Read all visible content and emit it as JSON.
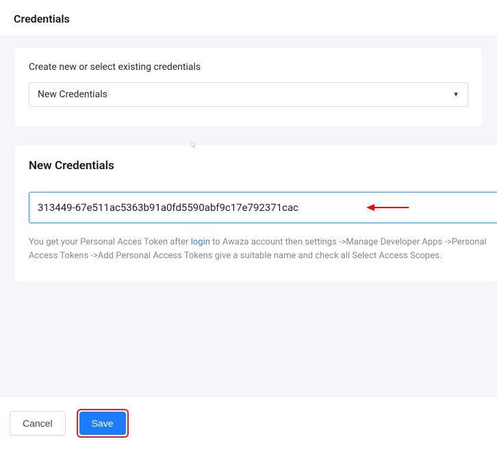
{
  "header": {
    "title": "Credentials"
  },
  "select_panel": {
    "label": "Create new or select existing credentials",
    "selected": "New Credentials"
  },
  "token_panel": {
    "heading": "New Credentials",
    "input_value": "313449-67e511ac5363b91a0fd5590abf9c17e792371cac",
    "help_pre": "You get your Personal Acces Token after ",
    "help_link": "login",
    "help_post": " to Awaza account then settings ->Manage Developer Apps ->Personal Access Tokens ->Add Personal Access Tokens give a suitable name and check all Select Access Scopes."
  },
  "footer": {
    "cancel": "Cancel",
    "save": "Save"
  }
}
